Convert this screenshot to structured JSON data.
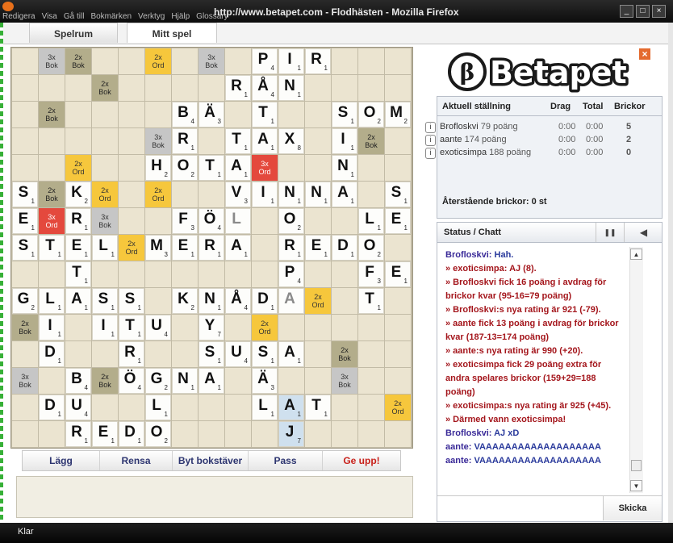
{
  "window": {
    "title": "http://www.betapet.com - Flodhästen - Mozilla Firefox",
    "menu": [
      "Redigera",
      "Visa",
      "Gå till",
      "Bokmärken",
      "Verktyg",
      "Hjälp",
      "Glossary"
    ],
    "status": "Klar"
  },
  "tabs": [
    {
      "label": "Spelrum",
      "active": false
    },
    {
      "label": "Mitt spel",
      "active": true
    }
  ],
  "logo": {
    "symbol": "β",
    "text": "Betapet"
  },
  "scoreboard": {
    "headers": {
      "standing": "Aktuell ställning",
      "drag": "Drag",
      "total": "Total",
      "tiles": "Brickor"
    },
    "players": [
      {
        "name": "Brofloskvi",
        "points": "79 poäng",
        "drag": "0:00",
        "total": "0:00",
        "tiles": "5"
      },
      {
        "name": "aante",
        "points": "174 poäng",
        "drag": "0:00",
        "total": "0:00",
        "tiles": "2"
      },
      {
        "name": "exoticsimpa",
        "points": "188 poäng",
        "drag": "0:00",
        "total": "0:00",
        "tiles": "0"
      }
    ],
    "info_glyph": "i",
    "remaining": "Återstående brickor: 0 st"
  },
  "chat": {
    "title": "Status / Chatt",
    "pause_icon": "❚❚",
    "sound_icon": "◀",
    "messages": [
      {
        "type": "user",
        "name": "Brofloskvi:",
        "text": " Hah."
      },
      {
        "type": "sys",
        "text": "» exoticsimpa: AJ (8)."
      },
      {
        "type": "sys",
        "text": "» Brofloskvi fick 16 poäng i avdrag för brickor kvar (95-16=79 poäng)"
      },
      {
        "type": "sys",
        "text": "» Brofloskvi:s nya rating är 921 (-79)."
      },
      {
        "type": "sys",
        "text": "» aante fick 13 poäng i avdrag för brickor kvar (187-13=174 poäng)"
      },
      {
        "type": "sys",
        "text": "» aante:s nya rating är 990 (+20)."
      },
      {
        "type": "sys",
        "text": "» exoticsimpa fick 29 poäng extra för andra spelares brickor (159+29=188 poäng)"
      },
      {
        "type": "sys",
        "text": "» exoticsimpa:s nya rating är 925 (+45)."
      },
      {
        "type": "sys",
        "text": "» Därmed vann exoticsimpa!"
      },
      {
        "type": "user",
        "name": "Brofloskvi:",
        "text": " AJ xD"
      },
      {
        "type": "user",
        "name": "aante:",
        "text": " VAAAAAAAAAAAAAAAAAAA"
      },
      {
        "type": "user",
        "name": "aante:",
        "text": " VAAAAAAAAAAAAAAAAAAA"
      }
    ],
    "input_value": "",
    "send_label": "Skicka",
    "scroll_up": "▲",
    "scroll_down": "▼"
  },
  "actions": [
    {
      "label": "Lägg",
      "danger": false
    },
    {
      "label": "Rensa",
      "danger": false
    },
    {
      "label": "Byt bokstäver",
      "danger": false
    },
    {
      "label": "Pass",
      "danger": false
    },
    {
      "label": "Ge upp!",
      "danger": true
    }
  ],
  "board": {
    "size": 15,
    "bonus_labels": {
      "tw": "3x\nOrd",
      "dw": "2x\nOrd",
      "tl": "3x\nBok",
      "dl": "2x\nBok"
    },
    "premium": [
      [
        "",
        "tl",
        "dl",
        "",
        "",
        "dw",
        "",
        "tl",
        "",
        "",
        "",
        "",
        "",
        "",
        ""
      ],
      [
        "",
        "",
        "",
        "dl",
        "",
        "",
        "",
        "",
        "",
        "",
        "",
        "",
        "",
        "",
        ""
      ],
      [
        "",
        "dl",
        "",
        "",
        "",
        "",
        "",
        "",
        "",
        "",
        "",
        "",
        "",
        "",
        ""
      ],
      [
        "",
        "",
        "",
        "",
        "",
        "tl",
        "",
        "",
        "",
        "",
        "",
        "",
        "",
        "dl",
        ""
      ],
      [
        "",
        "",
        "dw",
        "",
        "",
        "",
        "",
        "",
        "",
        "tw",
        "",
        "",
        "",
        "",
        ""
      ],
      [
        "",
        "dl",
        "",
        "dw",
        "",
        "dw",
        "",
        "",
        "",
        "",
        "",
        "",
        "",
        "",
        ""
      ],
      [
        "",
        "tw",
        "",
        "tl",
        "",
        "",
        "",
        "",
        "",
        "",
        "",
        "",
        "",
        "",
        ""
      ],
      [
        "",
        "",
        "",
        "",
        "dw",
        "",
        "",
        "",
        "",
        "",
        "",
        "",
        "",
        "",
        ""
      ],
      [
        "",
        "",
        "",
        "",
        "",
        "",
        "",
        "",
        "",
        "",
        "",
        "",
        "",
        "",
        ""
      ],
      [
        "",
        "",
        "",
        "",
        "",
        "",
        "",
        "",
        "",
        "",
        "",
        "dw",
        "",
        "",
        ""
      ],
      [
        "dl",
        "",
        "",
        "",
        "",
        "",
        "",
        "",
        "",
        "dw",
        "",
        "",
        "",
        "",
        ""
      ],
      [
        "",
        "",
        "",
        "",
        "",
        "",
        "",
        "",
        "",
        "",
        "",
        "",
        "dl",
        "",
        ""
      ],
      [
        "tl",
        "",
        "",
        "dl",
        "",
        "",
        "",
        "",
        "",
        "",
        "",
        "",
        "tl",
        "",
        ""
      ],
      [
        "",
        "",
        "",
        "",
        "",
        "",
        "",
        "",
        "",
        "",
        "",
        "",
        "",
        "",
        "dw"
      ],
      [
        "",
        "",
        "",
        "",
        "",
        "",
        "",
        "",
        "",
        "",
        "",
        "",
        "",
        "",
        ""
      ]
    ],
    "tiles": [
      {
        "r": 0,
        "c": 9,
        "l": "P",
        "p": "4"
      },
      {
        "r": 0,
        "c": 10,
        "l": "I",
        "p": "1"
      },
      {
        "r": 0,
        "c": 11,
        "l": "R",
        "p": "1"
      },
      {
        "r": 1,
        "c": 8,
        "l": "R",
        "p": "1"
      },
      {
        "r": 1,
        "c": 9,
        "l": "Å",
        "p": "4"
      },
      {
        "r": 1,
        "c": 10,
        "l": "N",
        "p": "1"
      },
      {
        "r": 2,
        "c": 6,
        "l": "B",
        "p": "4"
      },
      {
        "r": 2,
        "c": 7,
        "l": "Ä",
        "p": "3"
      },
      {
        "r": 2,
        "c": 9,
        "l": "T",
        "p": "1"
      },
      {
        "r": 2,
        "c": 12,
        "l": "S",
        "p": "1"
      },
      {
        "r": 2,
        "c": 13,
        "l": "O",
        "p": "2"
      },
      {
        "r": 2,
        "c": 14,
        "l": "M",
        "p": "2"
      },
      {
        "r": 3,
        "c": 6,
        "l": "R",
        "p": "1"
      },
      {
        "r": 3,
        "c": 8,
        "l": "T",
        "p": "1"
      },
      {
        "r": 3,
        "c": 9,
        "l": "A",
        "p": "1"
      },
      {
        "r": 3,
        "c": 10,
        "l": "X",
        "p": "8"
      },
      {
        "r": 3,
        "c": 12,
        "l": "I",
        "p": "1"
      },
      {
        "r": 4,
        "c": 5,
        "l": "H",
        "p": "2"
      },
      {
        "r": 4,
        "c": 6,
        "l": "O",
        "p": "2"
      },
      {
        "r": 4,
        "c": 7,
        "l": "T",
        "p": "1"
      },
      {
        "r": 4,
        "c": 8,
        "l": "A",
        "p": "1"
      },
      {
        "r": 4,
        "c": 12,
        "l": "N",
        "p": "1"
      },
      {
        "r": 5,
        "c": 0,
        "l": "S",
        "p": "1"
      },
      {
        "r": 5,
        "c": 2,
        "l": "K",
        "p": "2"
      },
      {
        "r": 5,
        "c": 8,
        "l": "V",
        "p": "3"
      },
      {
        "r": 5,
        "c": 9,
        "l": "I",
        "p": "1"
      },
      {
        "r": 5,
        "c": 10,
        "l": "N",
        "p": "1"
      },
      {
        "r": 5,
        "c": 11,
        "l": "N",
        "p": "1"
      },
      {
        "r": 5,
        "c": 12,
        "l": "A",
        "p": "1"
      },
      {
        "r": 5,
        "c": 14,
        "l": "S",
        "p": "1"
      },
      {
        "r": 6,
        "c": 0,
        "l": "E",
        "p": "1"
      },
      {
        "r": 6,
        "c": 2,
        "l": "R",
        "p": "1"
      },
      {
        "r": 6,
        "c": 6,
        "l": "F",
        "p": "3"
      },
      {
        "r": 6,
        "c": 7,
        "l": "Ö",
        "p": "4"
      },
      {
        "r": 6,
        "c": 8,
        "l": "L",
        "p": "",
        "grey": true
      },
      {
        "r": 6,
        "c": 10,
        "l": "O",
        "p": "2"
      },
      {
        "r": 6,
        "c": 13,
        "l": "L",
        "p": "1"
      },
      {
        "r": 6,
        "c": 14,
        "l": "E",
        "p": "1"
      },
      {
        "r": 7,
        "c": 0,
        "l": "S",
        "p": "1"
      },
      {
        "r": 7,
        "c": 1,
        "l": "T",
        "p": "1"
      },
      {
        "r": 7,
        "c": 2,
        "l": "E",
        "p": "1"
      },
      {
        "r": 7,
        "c": 3,
        "l": "L",
        "p": "1"
      },
      {
        "r": 7,
        "c": 5,
        "l": "M",
        "p": "3"
      },
      {
        "r": 7,
        "c": 6,
        "l": "E",
        "p": "1"
      },
      {
        "r": 7,
        "c": 7,
        "l": "R",
        "p": "1"
      },
      {
        "r": 7,
        "c": 8,
        "l": "A",
        "p": "1"
      },
      {
        "r": 7,
        "c": 10,
        "l": "R",
        "p": "1"
      },
      {
        "r": 7,
        "c": 11,
        "l": "E",
        "p": "1"
      },
      {
        "r": 7,
        "c": 12,
        "l": "D",
        "p": "1"
      },
      {
        "r": 7,
        "c": 13,
        "l": "O",
        "p": "2"
      },
      {
        "r": 8,
        "c": 2,
        "l": "T",
        "p": "1"
      },
      {
        "r": 8,
        "c": 10,
        "l": "P",
        "p": "4"
      },
      {
        "r": 8,
        "c": 13,
        "l": "F",
        "p": "3"
      },
      {
        "r": 8,
        "c": 14,
        "l": "E",
        "p": "1"
      },
      {
        "r": 9,
        "c": 0,
        "l": "G",
        "p": "2"
      },
      {
        "r": 9,
        "c": 1,
        "l": "L",
        "p": "1"
      },
      {
        "r": 9,
        "c": 2,
        "l": "A",
        "p": "1"
      },
      {
        "r": 9,
        "c": 3,
        "l": "S",
        "p": "1"
      },
      {
        "r": 9,
        "c": 4,
        "l": "S",
        "p": "1"
      },
      {
        "r": 9,
        "c": 6,
        "l": "K",
        "p": "2"
      },
      {
        "r": 9,
        "c": 7,
        "l": "N",
        "p": "1"
      },
      {
        "r": 9,
        "c": 8,
        "l": "Å",
        "p": "4"
      },
      {
        "r": 9,
        "c": 9,
        "l": "D",
        "p": "1"
      },
      {
        "r": 9,
        "c": 10,
        "l": "A",
        "p": "",
        "grey": true
      },
      {
        "r": 9,
        "c": 13,
        "l": "T",
        "p": "1"
      },
      {
        "r": 10,
        "c": 1,
        "l": "I",
        "p": "1"
      },
      {
        "r": 10,
        "c": 3,
        "l": "I",
        "p": "1"
      },
      {
        "r": 10,
        "c": 4,
        "l": "T",
        "p": "1"
      },
      {
        "r": 10,
        "c": 5,
        "l": "U",
        "p": "4"
      },
      {
        "r": 10,
        "c": 7,
        "l": "Y",
        "p": "7"
      },
      {
        "r": 11,
        "c": 1,
        "l": "D",
        "p": "1"
      },
      {
        "r": 11,
        "c": 4,
        "l": "R",
        "p": "1"
      },
      {
        "r": 11,
        "c": 7,
        "l": "S",
        "p": "1"
      },
      {
        "r": 11,
        "c": 8,
        "l": "U",
        "p": "4"
      },
      {
        "r": 11,
        "c": 9,
        "l": "S",
        "p": "1"
      },
      {
        "r": 11,
        "c": 10,
        "l": "A",
        "p": "1"
      },
      {
        "r": 12,
        "c": 2,
        "l": "B",
        "p": "4"
      },
      {
        "r": 12,
        "c": 4,
        "l": "Ö",
        "p": "4"
      },
      {
        "r": 12,
        "c": 5,
        "l": "G",
        "p": "2"
      },
      {
        "r": 12,
        "c": 6,
        "l": "N",
        "p": "1"
      },
      {
        "r": 12,
        "c": 7,
        "l": "A",
        "p": "1"
      },
      {
        "r": 12,
        "c": 9,
        "l": "Ä",
        "p": "3"
      },
      {
        "r": 13,
        "c": 1,
        "l": "D",
        "p": "1"
      },
      {
        "r": 13,
        "c": 2,
        "l": "U",
        "p": "4"
      },
      {
        "r": 13,
        "c": 5,
        "l": "L",
        "p": "1"
      },
      {
        "r": 13,
        "c": 9,
        "l": "L",
        "p": "1"
      },
      {
        "r": 13,
        "c": 10,
        "l": "A",
        "p": "1",
        "tmp": true
      },
      {
        "r": 13,
        "c": 11,
        "l": "T",
        "p": "1"
      },
      {
        "r": 14,
        "c": 2,
        "l": "R",
        "p": "1"
      },
      {
        "r": 14,
        "c": 3,
        "l": "E",
        "p": "1"
      },
      {
        "r": 14,
        "c": 4,
        "l": "D",
        "p": "1"
      },
      {
        "r": 14,
        "c": 5,
        "l": "O",
        "p": "2"
      },
      {
        "r": 14,
        "c": 10,
        "l": "J",
        "p": "7",
        "tmp": true
      }
    ]
  }
}
